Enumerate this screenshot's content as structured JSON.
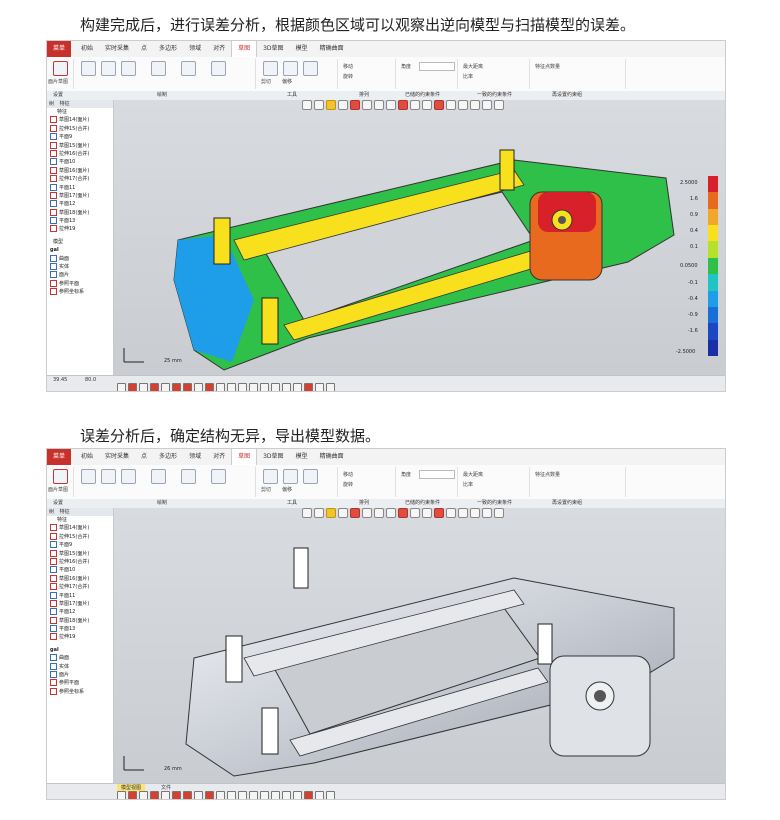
{
  "captions": {
    "top": "构建完成后，进行误差分析，根据颜色区域可以观察出逆向模型与扫描模型的误差。",
    "bottom": "误差分析后，确定结构无异，导出模型数据。"
  },
  "app": {
    "file_tab": "菜单",
    "tabs": [
      "初始",
      "实时采集",
      "点",
      "多边形",
      "领域",
      "对齐",
      "草图",
      "3D草图",
      "模型",
      "精确曲面"
    ],
    "active_tab": "草图",
    "ribbon_groups": [
      "设置",
      "绘制",
      "工具",
      "排列",
      "已储的约束条件",
      "一致的约束条件",
      "再设置约束组"
    ],
    "ribbon_labels": {
      "setting_btn": "面片草图",
      "tool_a": "剪切",
      "tool_b": "偏移",
      "align_a": "移动",
      "align_b": "旋转",
      "tolerance_label": "角度",
      "max_dist_label": "最大距离",
      "scale_label": "比率",
      "sample_label": "特征点数量"
    },
    "tree": {
      "header_a": "树",
      "header_b": "特征",
      "section": "特征",
      "top_items": [
        {
          "label": "草图14(面片)",
          "red": true
        },
        {
          "label": "拉伸15(合并)",
          "red": true
        },
        {
          "label": "平面9",
          "red": false
        },
        {
          "label": "草图15(面片)",
          "red": true
        },
        {
          "label": "拉伸16(合并)",
          "red": true
        },
        {
          "label": "平面10",
          "red": false
        },
        {
          "label": "草图16(面片)",
          "red": true
        },
        {
          "label": "拉伸17(合并)",
          "red": true
        },
        {
          "label": "平面11",
          "red": false
        },
        {
          "label": "草图17(面片)",
          "red": true
        },
        {
          "label": "平面12",
          "red": false
        },
        {
          "label": "草图18(面片)",
          "red": true
        },
        {
          "label": "平面13",
          "red": false
        },
        {
          "label": "拉伸19",
          "red": true
        }
      ],
      "model_section": "模型",
      "model_root": "gal",
      "model_items": [
        "曲面",
        "实体",
        "面片",
        "参照平面",
        "参照坐标系"
      ]
    },
    "status": {
      "tab_a": "模型视图",
      "tab_b": "文件",
      "coord_a": "39.45",
      "coord_b": "80.0",
      "scale_top": "25 mm",
      "scale_bottom": "26 mm"
    },
    "legend": {
      "values": [
        "2.5000",
        "1.6",
        "0.9",
        "0.4",
        "0.1",
        "0.0500",
        "-0.1",
        "-0.4",
        "-0.9",
        "-1.6",
        "-2.5000"
      ],
      "colors": [
        "#d8202a",
        "#e86a1f",
        "#f0a72a",
        "#f8e11c",
        "#b7e02a",
        "#2fc04a",
        "#1fc4c4",
        "#1e9ee8",
        "#1a6ed8",
        "#1848c4",
        "#1a2ea8"
      ]
    }
  }
}
